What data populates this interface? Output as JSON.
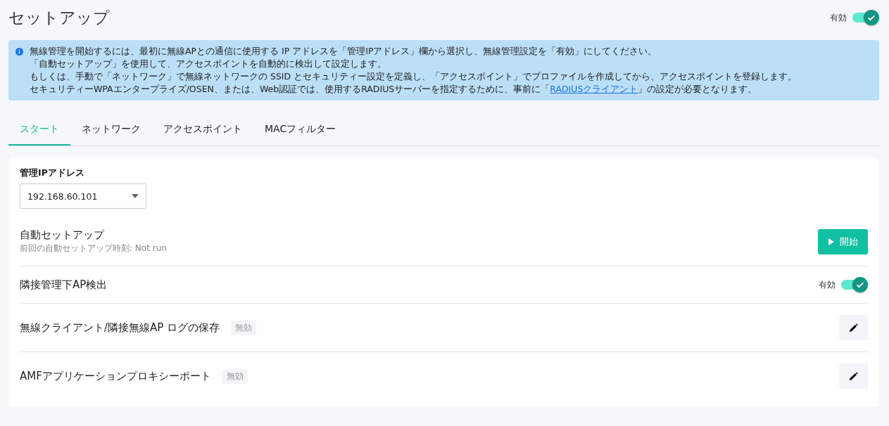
{
  "page": {
    "title": "セットアップ",
    "toggle": {
      "label": "有効",
      "on": true
    }
  },
  "info": {
    "lines": [
      "無線管理を開始するには、最初に無線APとの通信に使用する IP アドレスを「管理IPアドレス」欄から選択し、無線管理設定を「有効」にしてください。",
      "「自動セットアップ」を使用して、アクセスポイントを自動的に検出して設定します。",
      "もしくは、手動で「ネットワーク」で無線ネットワークの SSID とセキュリティー設定を定義し、「アクセスポイント」でプロファイルを作成してから、アクセスポイントを登録します。"
    ],
    "last_line": {
      "before": "セキュリティーWPAエンタープライズ/OSEN、または、Web認証では、使用するRADIUSサーバーを指定するために、事前に「",
      "link": "RADIUSクライアント",
      "after": "」の設定が必要となります。"
    }
  },
  "tabs": [
    {
      "label": "スタート",
      "selected": true
    },
    {
      "label": "ネットワーク",
      "selected": false
    },
    {
      "label": "アクセスポイント",
      "selected": false
    },
    {
      "label": "MACフィルター",
      "selected": false
    }
  ],
  "ip_field": {
    "label": "管理IPアドレス",
    "value": "192.168.60.101"
  },
  "rows": [
    {
      "kind": "action",
      "title": "自動セットアップ",
      "subtitle": "前回の自動セットアップ時刻: Not run",
      "button": "開始"
    },
    {
      "kind": "toggle",
      "title": "隣接管理下AP検出",
      "label": "有効",
      "on": true
    },
    {
      "kind": "edit",
      "title": "無線クライアント/隣接無線AP ログの保存",
      "badge": "無効"
    },
    {
      "kind": "edit",
      "title": "AMFアプリケーションプロキシーポート",
      "badge": "無効"
    }
  ]
}
